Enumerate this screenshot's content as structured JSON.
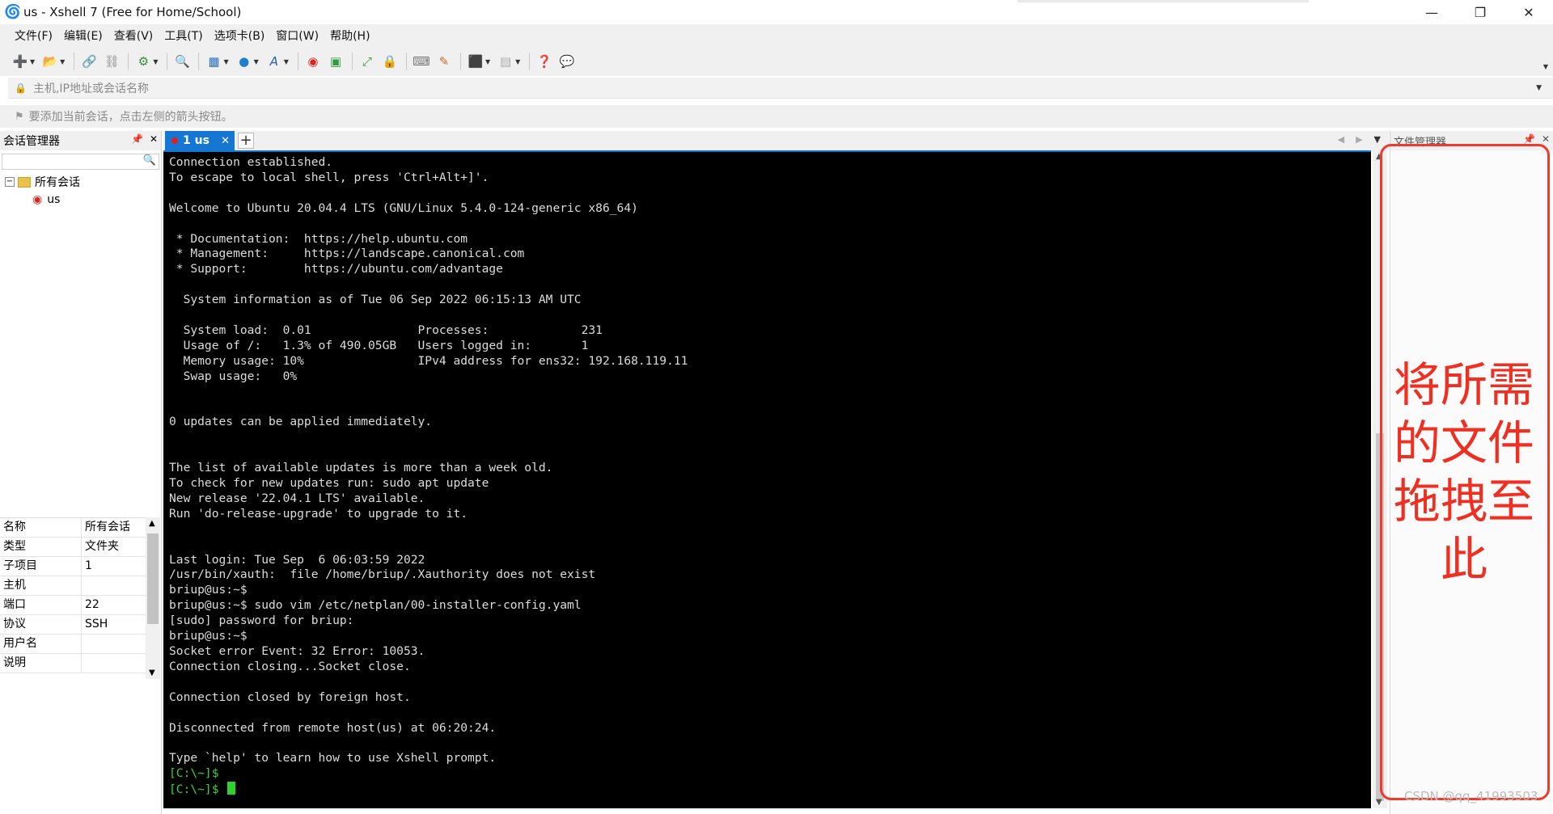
{
  "window": {
    "title": "us - Xshell 7 (Free for Home/School)",
    "controls": [
      "minimize-icon",
      "restore-icon",
      "close-icon"
    ]
  },
  "menu": [
    "文件(F)",
    "编辑(E)",
    "查看(V)",
    "工具(T)",
    "选项卡(B)",
    "窗口(W)",
    "帮助(H)"
  ],
  "toolbar_icons": [
    "new-session-icon",
    "open-folder-icon",
    "link-icon",
    "unlink-icon",
    "properties-icon",
    "find-icon",
    "sftp-icon",
    "globe-icon",
    "font-icon",
    "xshell-icon",
    "xftp-icon",
    "fullscreen-icon",
    "lock-icon",
    "keyboard-icon",
    "highlight-icon",
    "add-icon",
    "layout-icon",
    "help-icon",
    "chat-icon"
  ],
  "address": {
    "placeholder": "主机,IP地址或会话名称"
  },
  "hint": "要添加当前会话，点击左侧的箭头按钮。",
  "session_manager": {
    "title": "会话管理器",
    "tree_root": "所有会话",
    "tree_child": "us"
  },
  "properties": [
    {
      "key": "名称",
      "value": "所有会话"
    },
    {
      "key": "类型",
      "value": "文件夹"
    },
    {
      "key": "子项目",
      "value": "1"
    },
    {
      "key": "主机",
      "value": ""
    },
    {
      "key": "端口",
      "value": "22"
    },
    {
      "key": "协议",
      "value": "SSH"
    },
    {
      "key": "用户名",
      "value": ""
    },
    {
      "key": "说明",
      "value": ""
    }
  ],
  "tab": {
    "label": "1 us"
  },
  "terminal_lines": [
    "Connection established.",
    "To escape to local shell, press 'Ctrl+Alt+]'.",
    "",
    "Welcome to Ubuntu 20.04.4 LTS (GNU/Linux 5.4.0-124-generic x86_64)",
    "",
    " * Documentation:  https://help.ubuntu.com",
    " * Management:     https://landscape.canonical.com",
    " * Support:        https://ubuntu.com/advantage",
    "",
    "  System information as of Tue 06 Sep 2022 06:15:13 AM UTC",
    "",
    "  System load:  0.01               Processes:             231",
    "  Usage of /:   1.3% of 490.05GB   Users logged in:       1",
    "  Memory usage: 10%                IPv4 address for ens32: 192.168.119.11",
    "  Swap usage:   0%",
    "",
    "",
    "0 updates can be applied immediately.",
    "",
    "",
    "The list of available updates is more than a week old.",
    "To check for new updates run: sudo apt update",
    "New release '22.04.1 LTS' available.",
    "Run 'do-release-upgrade' to upgrade to it.",
    "",
    "",
    "Last login: Tue Sep  6 06:03:59 2022",
    "/usr/bin/xauth:  file /home/briup/.Xauthority does not exist",
    "briup@us:~$",
    "briup@us:~$ sudo vim /etc/netplan/00-installer-config.yaml",
    "[sudo] password for briup:",
    "briup@us:~$",
    "Socket error Event: 32 Error: 10053.",
    "Connection closing...Socket close.",
    "",
    "Connection closed by foreign host.",
    "",
    "Disconnected from remote host(us) at 06:20:24.",
    "",
    "Type `help' to learn how to use Xshell prompt."
  ],
  "prompt_lines": [
    "[C:\\~]$",
    "[C:\\~]$"
  ],
  "file_manager": {
    "title": "文件管理器",
    "annotation": "将所需的文件拖拽至此"
  },
  "watermark": "CSDN @qq_41993503",
  "colors": {
    "tab_active": "#1677d2",
    "terminal_bg": "#000000",
    "prompt": "#3cd03c",
    "annotation": "#ee2f22"
  }
}
